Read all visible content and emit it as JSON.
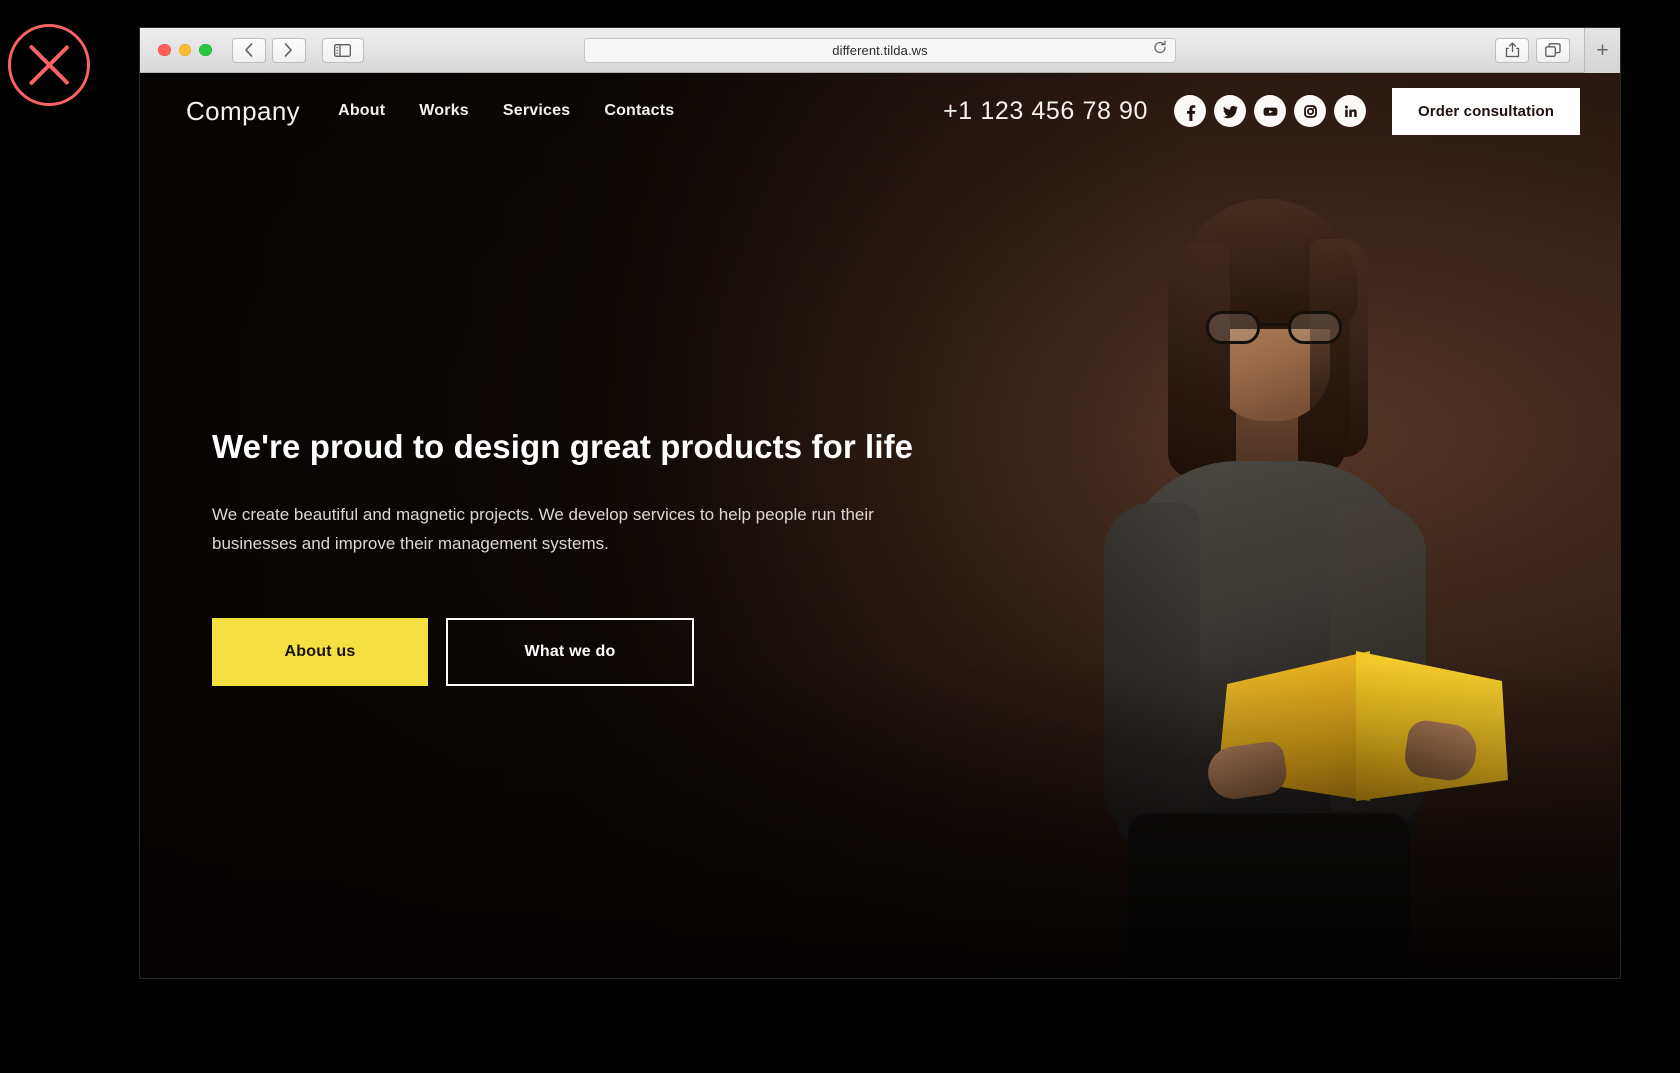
{
  "annotation": {
    "marker": "close-x-marker",
    "color": "#FB6362"
  },
  "browser": {
    "url": "different.tilda.ws",
    "controls": {
      "back": "‹",
      "forward": "›",
      "sidebar": "sidebar-icon",
      "reload": "⟳",
      "share": "share-icon",
      "tabs": "tabs-icon",
      "new_tab": "+"
    }
  },
  "site": {
    "header": {
      "logo": "Company",
      "nav": [
        {
          "label": "About"
        },
        {
          "label": "Works"
        },
        {
          "label": "Services"
        },
        {
          "label": "Contacts"
        }
      ],
      "phone": "+1 123 456 78 90",
      "socials": [
        {
          "name": "facebook-icon",
          "glyph": "f"
        },
        {
          "name": "twitter-icon",
          "glyph": "t"
        },
        {
          "name": "youtube-icon",
          "glyph": "y"
        },
        {
          "name": "instagram-icon",
          "glyph": "i"
        },
        {
          "name": "linkedin-icon",
          "glyph": "in"
        }
      ],
      "cta_label": "Order consultation"
    },
    "hero": {
      "title": "We're proud to design great products for life",
      "subtitle": "We create beautiful and magnetic projects. We develop services to help people run their businesses and improve their management systems.",
      "primary_button": "About us",
      "secondary_button": "What we do",
      "image_alt": "woman-reading-yellow-book"
    },
    "colors": {
      "accent_yellow": "#F5E042",
      "background_dark": "#130D0A",
      "text_light": "#FFFFFF"
    }
  }
}
